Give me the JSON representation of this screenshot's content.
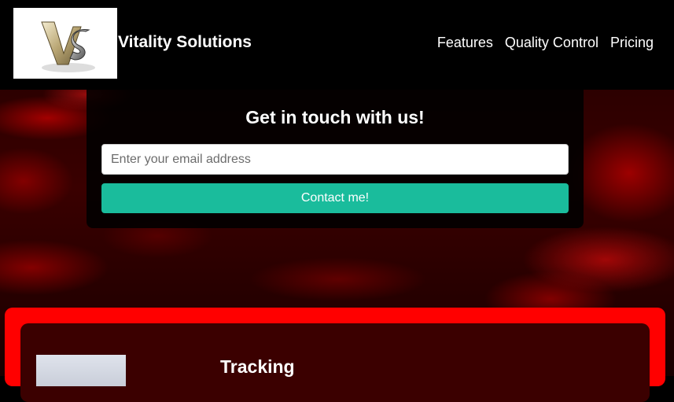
{
  "header": {
    "logo_alt": "VS logo",
    "brand": "Vitality Solutions",
    "nav": [
      {
        "label": "Features"
      },
      {
        "label": "Quality Control"
      },
      {
        "label": "Pricing"
      }
    ]
  },
  "contact": {
    "heading": "Get in touch with us!",
    "email_placeholder": "Enter your email address",
    "submit_label": "Contact me!"
  },
  "features": {
    "cards": [
      {
        "title": "Tracking"
      }
    ]
  },
  "colors": {
    "accent": "#1abc9c",
    "section_border": "#ff0000",
    "card_bg": "#3b0000",
    "header_bg": "#000000"
  }
}
